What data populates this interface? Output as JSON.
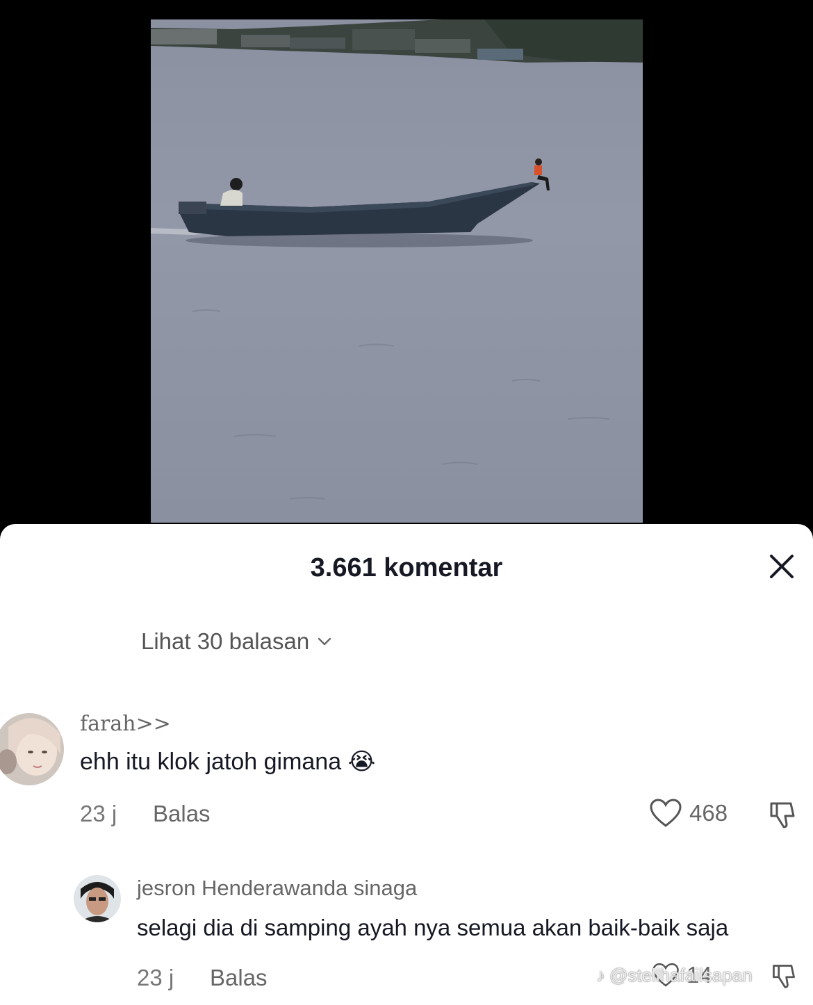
{
  "sheet": {
    "title": "3.661 komentar",
    "view_replies_label": "Lihat 30 balasan"
  },
  "comments": [
    {
      "username": "farah>>",
      "text": "ehh itu klok jatoh gimana",
      "emoji": "😭",
      "time": "23 j",
      "reply_label": "Balas",
      "likes": "468"
    },
    {
      "username": "jesron Henderawanda sinaga",
      "text": "selagi dia di samping ayah nya semua akan baik-baik saja",
      "time": "23 j",
      "reply_label": "Balas",
      "likes": "14"
    }
  ],
  "watermark": {
    "handle": "@stellhafailsapan"
  },
  "colors": {
    "sheet_bg": "#ffffff",
    "text_primary": "#161823",
    "text_secondary": "#666666",
    "water": "#8f95a5"
  }
}
